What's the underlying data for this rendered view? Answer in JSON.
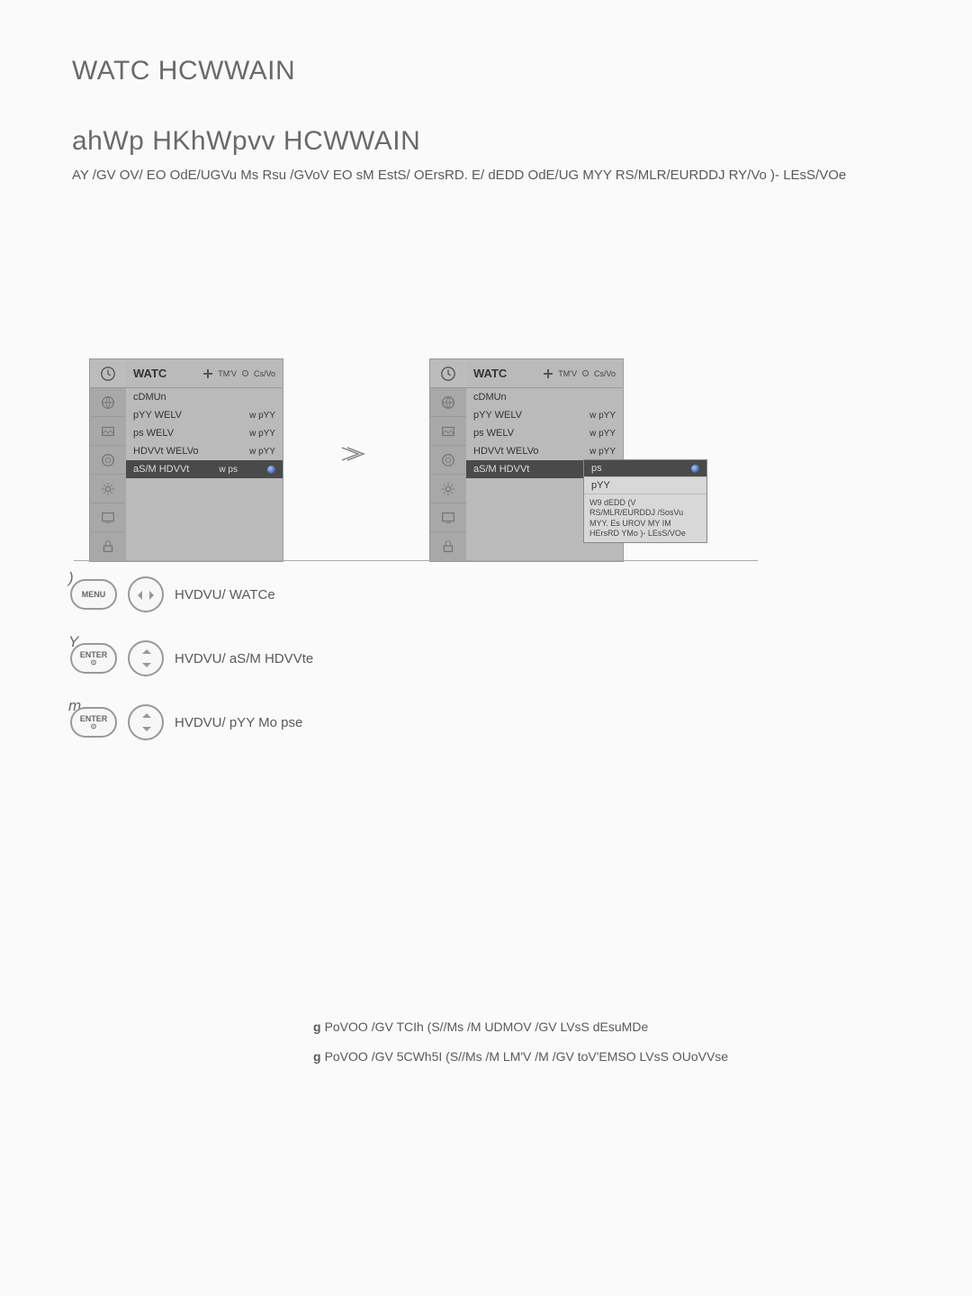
{
  "page_title": "WATC HCWWAIN",
  "section_title": "ahWp HKhWpvv HCWWAIN",
  "intro": "AY /GV OV/ EO OdE/UGVu Ms Rsu /GVoV EO sM EstS/ OErsRD. E/ dEDD OdE/UG MYY RS/MLR/EURDDJ RY/Vo )- LEsS/VOe",
  "osd": {
    "title": "WATC",
    "header_move": "TM'V",
    "header_enter": "Cs/Vo",
    "items": [
      {
        "label": "cDMUn",
        "value": ""
      },
      {
        "label": "pYY WELV",
        "value": "w pYY"
      },
      {
        "label": "ps WELV",
        "value": "w pYY"
      },
      {
        "label": "HDVVt WELVo",
        "value": "w pYY"
      },
      {
        "label": "aS/M HDVVt",
        "value": "w ps"
      }
    ]
  },
  "popup": {
    "opt_on": "ps",
    "opt_off": "pYY",
    "note": "W9 dEDD (V RS/MLR/EURDDJ /SosVu MYY. Es UROV MY IM HErsRD YMo )- LEsS/VOe"
  },
  "steps": {
    "s1_num": ")",
    "s1_btn": "MENU",
    "s1_text": "HVDVU/ WATCe",
    "s2_num": "Y",
    "s2_btn": "ENTER",
    "s2_text": "HVDVU/ aS/M HDVVte",
    "s3_num": "m",
    "s3_btn": "ENTER",
    "s3_text": "HVDVU/ pYY Mo pse"
  },
  "footer": {
    "line1": "PoVOO /GV TCIh (S//Ms /M UDMOV /GV LVsS dEsuMDe",
    "line2": "PoVOO /GV 5CWh5I (S//Ms /M LM'V /M /GV toV'EMSO LVsS OUoVVse"
  }
}
